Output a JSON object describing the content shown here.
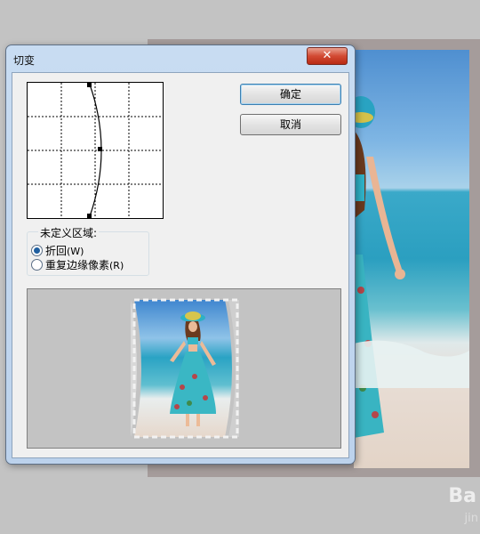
{
  "dialog": {
    "title": "切变",
    "close_label": "✕"
  },
  "buttons": {
    "ok": "确定",
    "cancel": "取消"
  },
  "undefined_area": {
    "legend": "未定义区域:",
    "options": [
      {
        "label": "折回",
        "hotkey": "(W)",
        "selected": true
      },
      {
        "label": "重复边缘像素",
        "hotkey": "(R)",
        "selected": false
      }
    ]
  },
  "watermark": {
    "text": "Ba",
    "sub": "jin"
  },
  "colors": {
    "dialog_frame": "#bcd2ec",
    "close_button": "#d24a33",
    "preview_bg": "#c3c3c3"
  }
}
